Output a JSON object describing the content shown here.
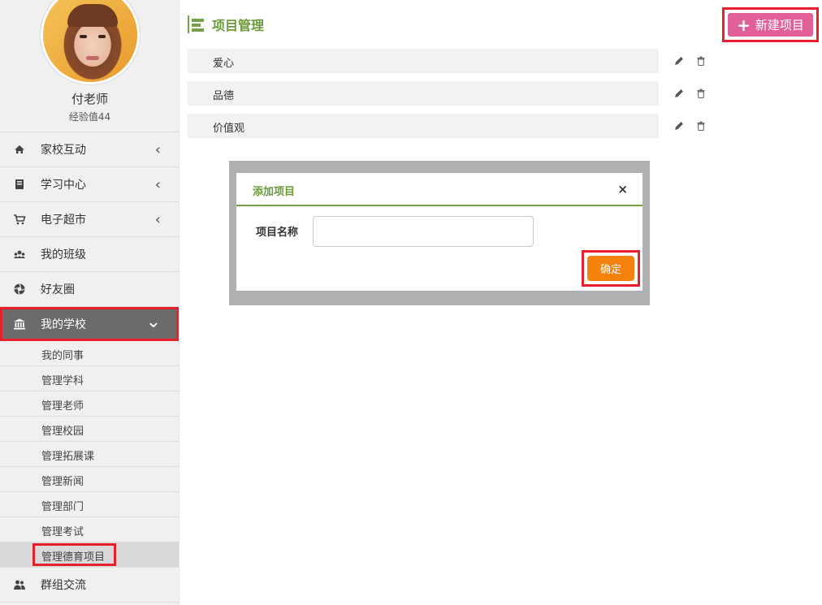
{
  "profile": {
    "name": "付老师",
    "experience": "经验值44"
  },
  "nav": {
    "items": [
      {
        "label": "家校互动",
        "icon": "home-icon",
        "chevron": "‹"
      },
      {
        "label": "学习中心",
        "icon": "book-icon",
        "chevron": "‹"
      },
      {
        "label": "电子超市",
        "icon": "cart-icon",
        "chevron": "‹"
      },
      {
        "label": "我的班级",
        "icon": "group-icon",
        "chevron": ""
      },
      {
        "label": "好友圈",
        "icon": "aperture-icon",
        "chevron": ""
      },
      {
        "label": "我的学校",
        "icon": "bank-icon",
        "chevron": "⌄"
      }
    ],
    "sub_items": [
      "我的同事",
      "管理学科",
      "管理老师",
      "管理校园",
      "管理拓展课",
      "管理新闻",
      "管理部门",
      "管理考试",
      "管理德育项目"
    ],
    "after": {
      "label": "群组交流",
      "icon": "users-icon"
    }
  },
  "main": {
    "title": "项目管理",
    "new_button": "新建项目",
    "new_button_icon": "plus-icon",
    "rows": [
      "爱心",
      "品德",
      "价值观"
    ]
  },
  "modal": {
    "title": "添加项目",
    "close": "×",
    "field_label": "项目名称",
    "field_value": "",
    "field_placeholder": "",
    "confirm": "确定"
  },
  "colors": {
    "accent_green": "#6a9a3a",
    "pink_button": "#e2609a",
    "orange_button": "#f5820d",
    "highlight_red": "#e8202c"
  }
}
